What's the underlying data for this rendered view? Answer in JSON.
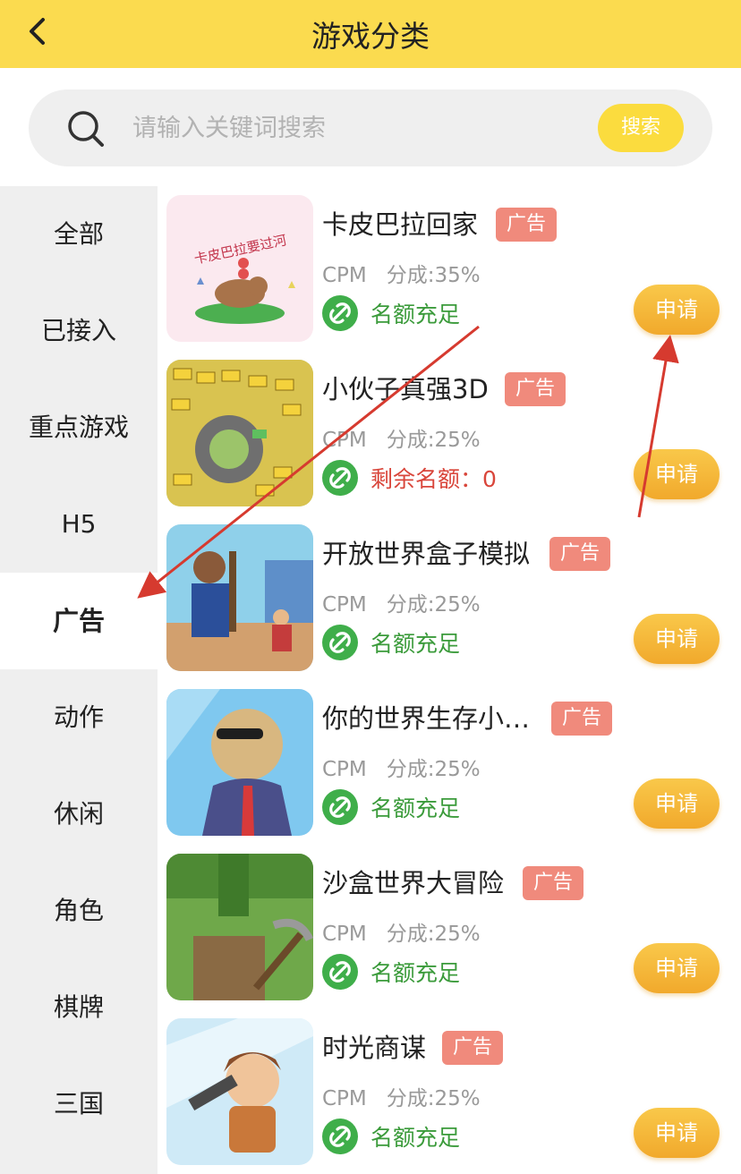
{
  "header": {
    "title": "游戏分类"
  },
  "search": {
    "placeholder": "请输入关键词搜索",
    "button_label": "搜索"
  },
  "sidebar": {
    "items": [
      {
        "label": "全部",
        "active": false
      },
      {
        "label": "已接入",
        "active": false
      },
      {
        "label": "重点游戏",
        "active": false
      },
      {
        "label": "H5",
        "active": false
      },
      {
        "label": "广告",
        "active": true
      },
      {
        "label": "动作",
        "active": false
      },
      {
        "label": "休闲",
        "active": false
      },
      {
        "label": "角色",
        "active": false
      },
      {
        "label": "棋牌",
        "active": false
      },
      {
        "label": "三国",
        "active": false
      }
    ]
  },
  "games": [
    {
      "name": "卡皮巴拉回家",
      "badge": "广告",
      "metric": "CPM",
      "share": "分成:35%",
      "status": "名额充足",
      "apply": "申请",
      "thumb_text": "卡皮巴拉要过河"
    },
    {
      "name": "小伙子真强3D",
      "badge": "广告",
      "metric": "CPM",
      "share": "分成:25%",
      "status": "剩余名额：0",
      "apply": "申请"
    },
    {
      "name": "开放世界盒子模拟",
      "badge": "广告",
      "metric": "CPM",
      "share": "分成:25%",
      "status": "名额充足",
      "apply": "申请"
    },
    {
      "name": "你的世界生存小…",
      "badge": "广告",
      "metric": "CPM",
      "share": "分成:25%",
      "status": "名额充足",
      "apply": "申请"
    },
    {
      "name": "沙盒世界大冒险",
      "badge": "广告",
      "metric": "CPM",
      "share": "分成:25%",
      "status": "名额充足",
      "apply": "申请"
    },
    {
      "name": "时光商谋",
      "badge": "广告",
      "metric": "CPM",
      "share": "分成:25%",
      "status": "名额充足",
      "apply": "申请"
    }
  ],
  "colors": {
    "header_bg": "#fbdb4f",
    "badge_bg": "#f08a7c",
    "status_ok": "#3b9b3b",
    "status_low": "#d9463b",
    "apply_btn": "#f4b236",
    "annotation_arrow": "#d63a2f"
  }
}
